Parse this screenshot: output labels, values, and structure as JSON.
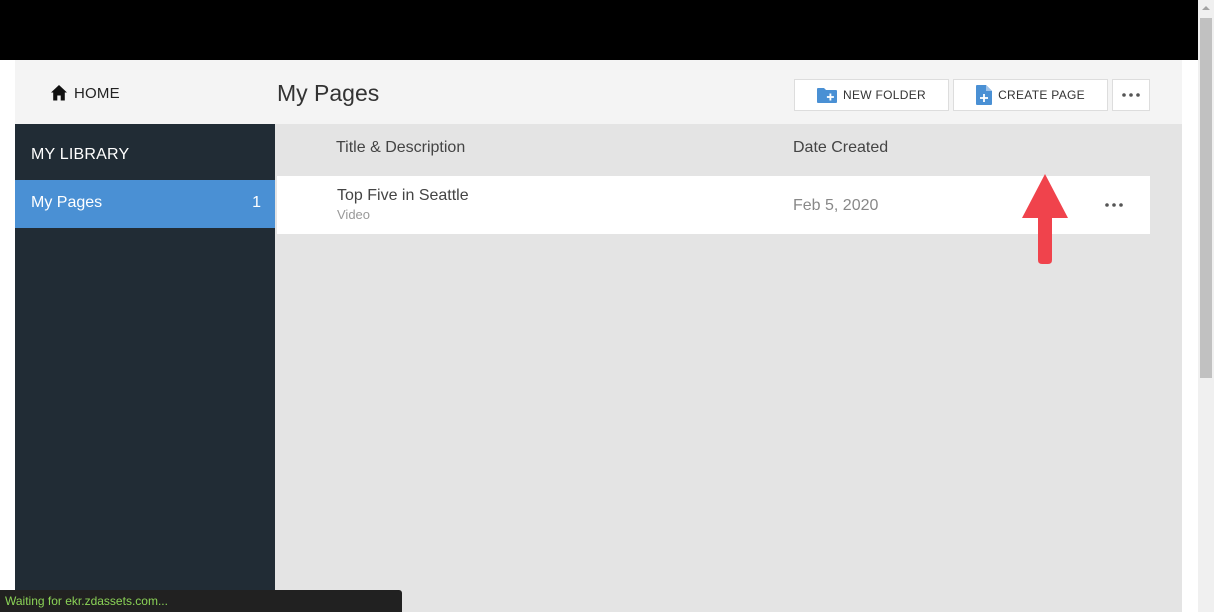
{
  "header": {
    "home_label": "HOME"
  },
  "sidebar": {
    "title": "MY LIBRARY",
    "items": [
      {
        "label": "My Pages",
        "count": "1"
      }
    ]
  },
  "main": {
    "title": "My Pages",
    "toolbar": {
      "new_folder_label": "NEW FOLDER",
      "create_page_label": "CREATE PAGE"
    },
    "columns": {
      "title": "Title & Description",
      "date": "Date Created"
    },
    "rows": [
      {
        "title": "Top Five in Seattle",
        "subtitle": "Video",
        "date": "Feb 5, 2020"
      }
    ]
  },
  "status": {
    "text": "Waiting for ekr.zdassets.com..."
  },
  "colors": {
    "accent": "#4a90d4",
    "sidebar_bg": "#212c35",
    "annotation_arrow": "#f0434c",
    "status_text": "#8bd357"
  },
  "icons": {
    "home": "home-icon",
    "new_folder": "folder-plus-icon",
    "create_page": "document-plus-icon",
    "more": "ellipsis-icon",
    "annotation": "red-arrow-up-icon"
  }
}
